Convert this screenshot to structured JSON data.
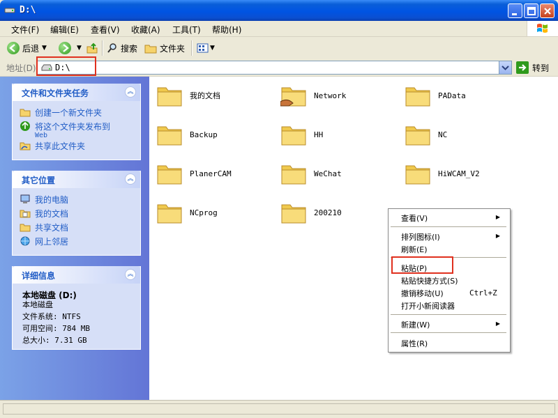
{
  "window": {
    "title": "D:\\"
  },
  "menu": [
    "文件(F)",
    "编辑(E)",
    "查看(V)",
    "收藏(A)",
    "工具(T)",
    "帮助(H)"
  ],
  "toolbar": {
    "back": "后退",
    "search": "搜索",
    "folders": "文件夹"
  },
  "address": {
    "label": "地址(D)",
    "value": "D:\\",
    "go": "转到"
  },
  "tasks_panel": {
    "title": "文件和文件夹任务",
    "items": [
      "创建一个新文件夹",
      "将这个文件夹发布到",
      "Web",
      "共享此文件夹"
    ]
  },
  "places_panel": {
    "title": "其它位置",
    "items": [
      "我的电脑",
      "我的文档",
      "共享文档",
      "网上邻居"
    ]
  },
  "details_panel": {
    "title": "详细信息",
    "name": "本地磁盘 (D:)",
    "type": "本地磁盘",
    "fs": "文件系统: NTFS",
    "free": "可用空间: 784 MB",
    "total": "总大小: 7.31 GB"
  },
  "files": [
    "我的文档",
    "Network",
    "PAData",
    "Backup",
    "HH",
    "NC",
    "PlanerCAM",
    "WeChat",
    "HiWCAM_V2",
    "NCprog",
    "200210"
  ],
  "context_menu": {
    "view": "查看(V)",
    "arrange": "排列图标(I)",
    "refresh": "刷新(E)",
    "paste": "粘贴(P)",
    "paste_shortcut": "粘贴快捷方式(S)",
    "undo_move": "撤销移动(U)",
    "undo_shortcut": "Ctrl+Z",
    "open_reader": "打开小新阅读器",
    "new": "新建(W)",
    "properties": "属性(R)"
  },
  "colors": {
    "title_blue": "#0054e3",
    "task_link": "#215dc6",
    "highlight_red": "#e0301e"
  }
}
